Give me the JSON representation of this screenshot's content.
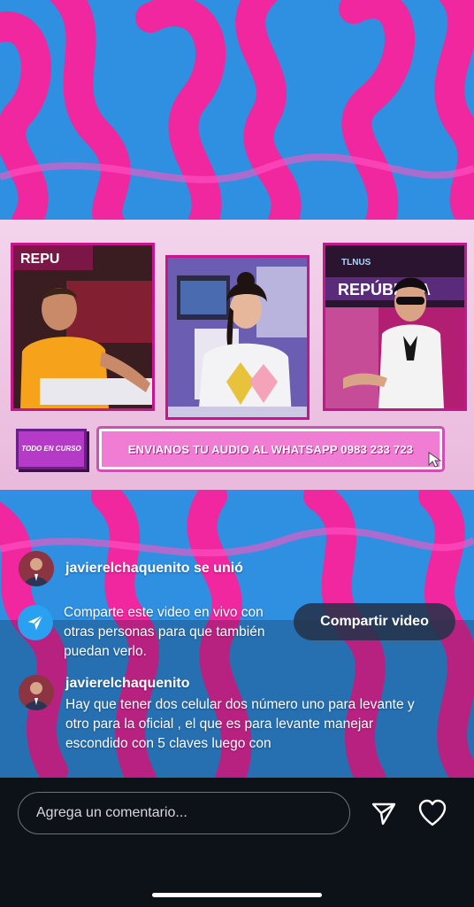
{
  "broadcast": {
    "badge_label": "TODO EN CURSO",
    "ticker_text": "ENVIANOS TU AUDIO AL WHATSAPP 0983 233 723",
    "cam1_logo": "REPU",
    "cam3_logo": "REPÚBLICA",
    "cam3_small": "TLNUS"
  },
  "live": {
    "join_message": "javierelchaquenito se unió",
    "share_prompt": "Comparte este video en vivo con otras personas para que también puedan verlo.",
    "share_button": "Compartir video",
    "comment": {
      "username": "javierelchaquenito",
      "text": "Hay que tener dos celular dos número uno para levante y otro para la oficial , el que es para levante manejar escondido con 5 claves luego con"
    }
  },
  "bottom_bar": {
    "comment_placeholder": "Agrega un comentario...",
    "icons": [
      "send-icon",
      "heart-icon"
    ]
  },
  "colors": {
    "background_pink": "#f0279f",
    "background_blue": "#2f8fe0",
    "accent_magenta": "#c7168b",
    "share_icon_blue": "#2aa0f1"
  }
}
